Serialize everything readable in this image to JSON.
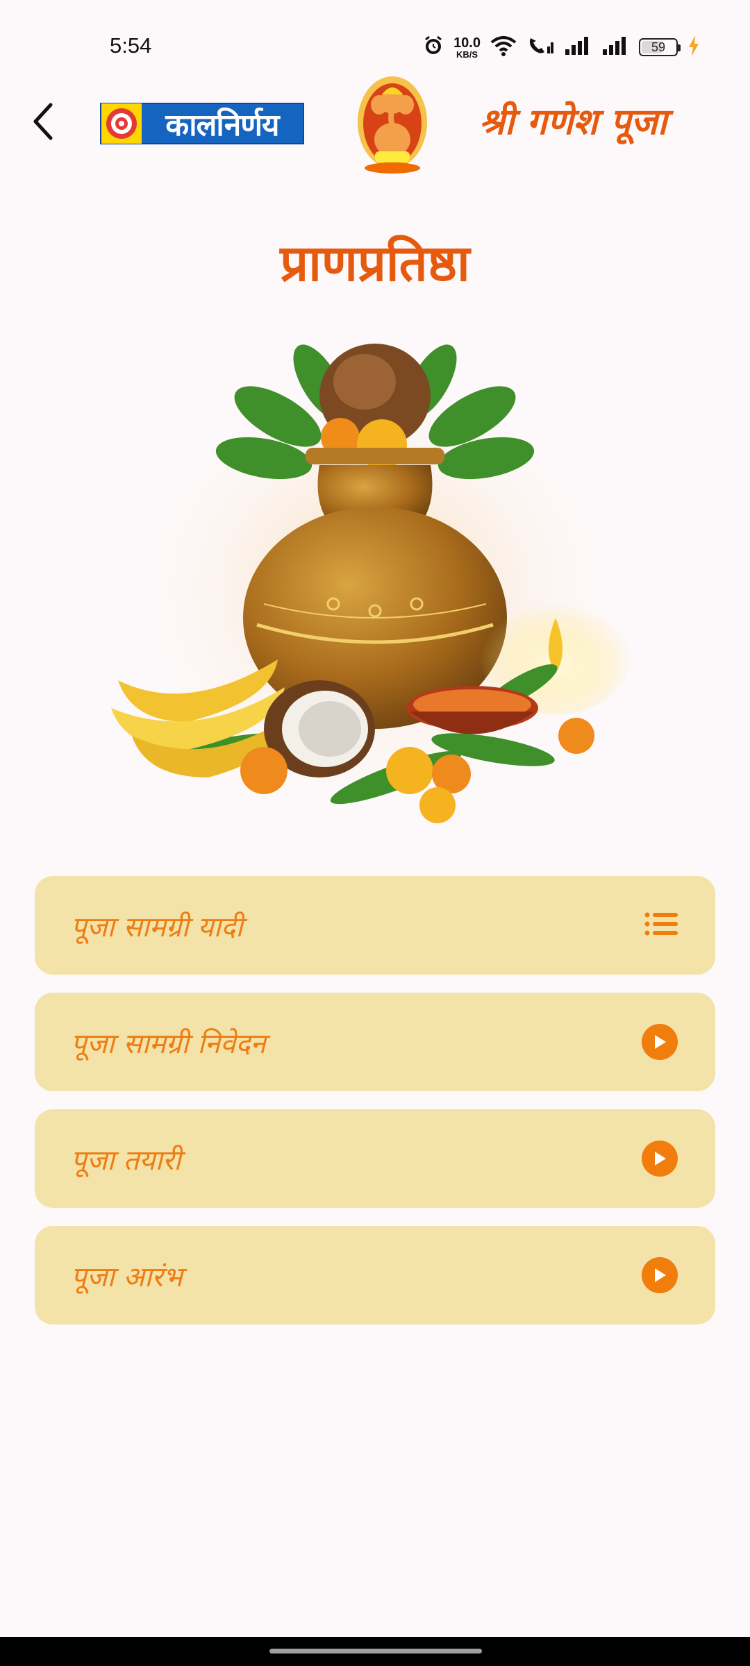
{
  "status_bar": {
    "time": "5:54",
    "net_speed_value": "10.0",
    "net_speed_unit": "KB/S",
    "battery": "59",
    "icons": [
      "alarm-icon",
      "wifi-icon",
      "wifi-calling-icon",
      "signal-icon",
      "signal-icon",
      "battery-icon",
      "charging-icon"
    ]
  },
  "header": {
    "back_icon": "chevron-left-icon",
    "brand_name": "कालनिर्णय",
    "title": "श्री गणेश पूजा"
  },
  "page": {
    "title": "प्राणप्रतिष्ठा"
  },
  "menu": {
    "items": [
      {
        "label": "पूजा सामग्री यादी",
        "icon": "list-icon"
      },
      {
        "label": "पूजा सामग्री निवेदन",
        "icon": "play-icon"
      },
      {
        "label": "पूजा तयारी",
        "icon": "play-icon"
      },
      {
        "label": "पूजा आरंभ",
        "icon": "play-icon"
      }
    ]
  },
  "colors": {
    "accent": "#e65a0e",
    "menu_bg": "#f3e3a8",
    "menu_text": "#ee7d14",
    "page_bg": "#fdf8fa"
  }
}
